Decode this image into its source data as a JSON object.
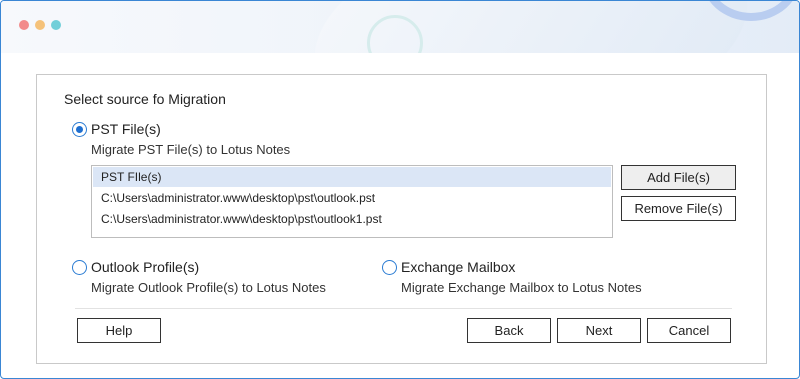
{
  "window": {
    "traffic_lights": [
      "close",
      "minimize",
      "maximize"
    ]
  },
  "page": {
    "heading": "Select source fo Migration"
  },
  "options": {
    "pst": {
      "label": "PST File(s)",
      "description": "Migrate PST File(s) to Lotus Notes",
      "selected": true
    },
    "outlook": {
      "label": "Outlook Profile(s)",
      "description": "Migrate Outlook Profile(s) to Lotus Notes",
      "selected": false
    },
    "exchange": {
      "label": "Exchange Mailbox",
      "description": "Migrate Exchange Mailbox to Lotus Notes",
      "selected": false
    }
  },
  "file_list": {
    "header": "PST FIle(s)",
    "items": [
      "C:\\Users\\administrator.www\\desktop\\pst\\outlook.pst",
      "C:\\Users\\administrator.www\\desktop\\pst\\outlook1.pst"
    ]
  },
  "buttons": {
    "add_files": "Add File(s)",
    "remove_files": "Remove File(s)",
    "help": "Help",
    "back": "Back",
    "next": "Next",
    "cancel": "Cancel"
  },
  "colors": {
    "accent": "#1e6fd0",
    "window_border": "#3a86d4",
    "list_header_bg": "#dbe6f6",
    "traffic_red": "#f28b8b",
    "traffic_yellow": "#f5c27a",
    "traffic_teal": "#72cfd9"
  }
}
